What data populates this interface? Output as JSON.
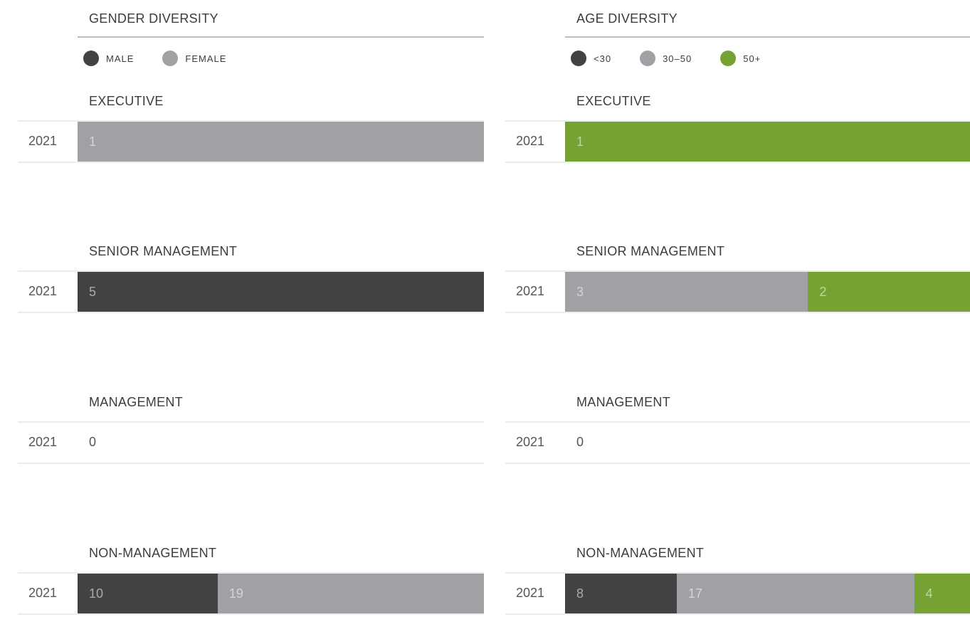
{
  "colors": {
    "male": "#424244",
    "female": "#a0a1a4",
    "under30": "#424244",
    "age30to50": "#a0a1a4",
    "over50": "#76a133"
  },
  "chart_data": [
    {
      "type": "bar",
      "title": "GENDER DIVERSITY",
      "stacked": true,
      "orientation": "horizontal",
      "legend": [
        {
          "label": "MALE",
          "color": "#424244"
        },
        {
          "label": "FEMALE",
          "color": "#a0a1a4"
        }
      ],
      "groups": [
        {
          "title": "EXECUTIVE",
          "year": "2021",
          "values": [
            0,
            1
          ]
        },
        {
          "title": "SENIOR MANAGEMENT",
          "year": "2021",
          "values": [
            5,
            0
          ]
        },
        {
          "title": "MANAGEMENT",
          "year": "2021",
          "values": [
            0,
            0
          ],
          "empty_label": "0"
        },
        {
          "title": "NON-MANAGEMENT",
          "year": "2021",
          "values": [
            10,
            19
          ]
        }
      ]
    },
    {
      "type": "bar",
      "title": "AGE DIVERSITY",
      "stacked": true,
      "orientation": "horizontal",
      "legend": [
        {
          "label": "<30",
          "color": "#424244"
        },
        {
          "label": "30–50",
          "color": "#a0a1a4"
        },
        {
          "label": "50+",
          "color": "#76a133"
        }
      ],
      "groups": [
        {
          "title": "EXECUTIVE",
          "year": "2021",
          "values": [
            0,
            0,
            1
          ]
        },
        {
          "title": "SENIOR MANAGEMENT",
          "year": "2021",
          "values": [
            0,
            3,
            2
          ]
        },
        {
          "title": "MANAGEMENT",
          "year": "2021",
          "values": [
            0,
            0,
            0
          ],
          "empty_label": "0"
        },
        {
          "title": "NON-MANAGEMENT",
          "year": "2021",
          "values": [
            8,
            17,
            4
          ]
        }
      ]
    }
  ]
}
